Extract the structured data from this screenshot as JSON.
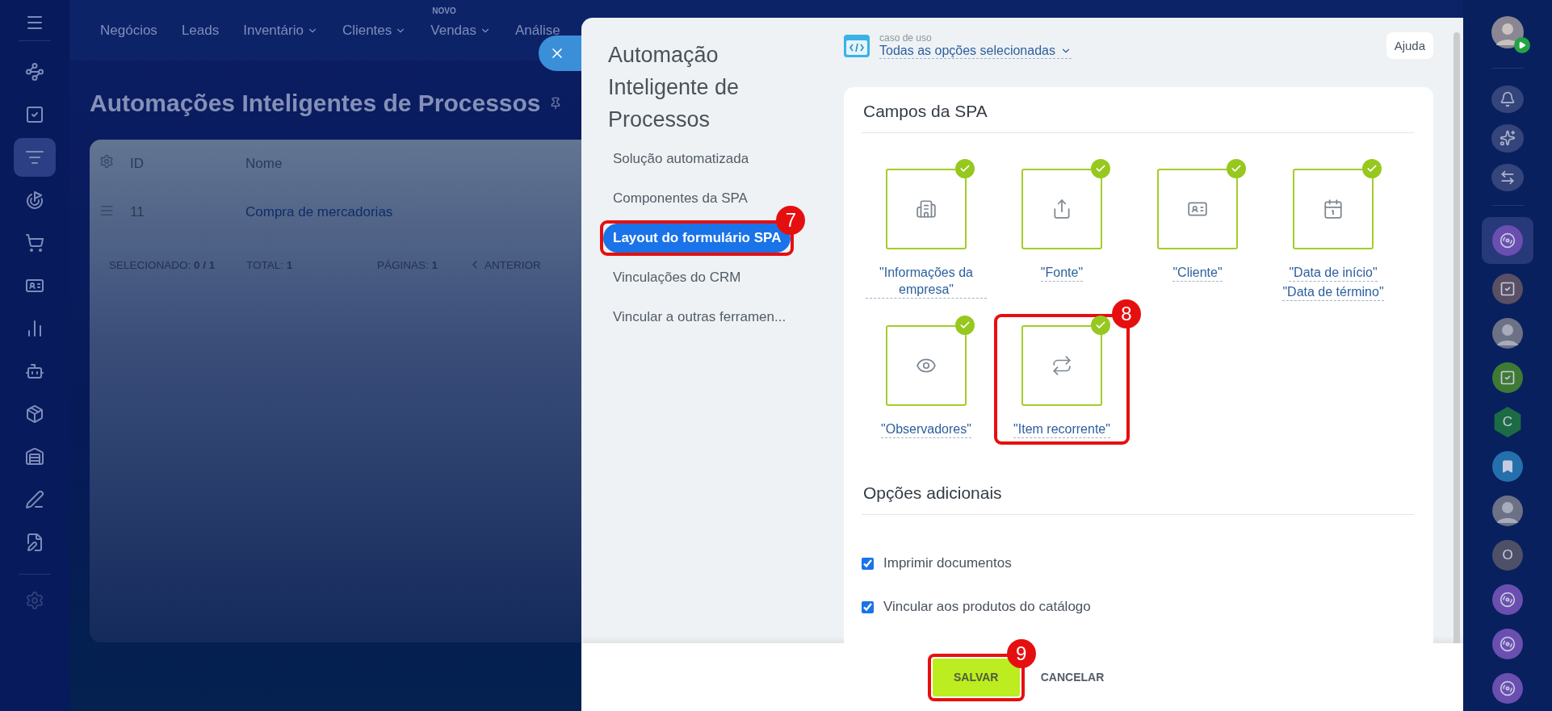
{
  "left_sidebar": {
    "items": [
      {
        "selected": false
      },
      {
        "selected": false
      },
      {
        "selected": true
      },
      {
        "selected": false
      },
      {
        "selected": false
      },
      {
        "selected": false
      },
      {
        "selected": false
      },
      {
        "selected": false
      },
      {
        "selected": false
      },
      {
        "selected": false
      },
      {
        "selected": false
      },
      {
        "selected": false
      }
    ]
  },
  "nav": [
    {
      "label": "Negócios",
      "dropdown": false
    },
    {
      "label": "Leads",
      "dropdown": false
    },
    {
      "label": "Inventário",
      "dropdown": true
    },
    {
      "label": "Clientes",
      "dropdown": true
    },
    {
      "label": "Vendas",
      "dropdown": true,
      "badge": "NOVO"
    },
    {
      "label": "Análise",
      "dropdown": false
    }
  ],
  "page": {
    "title": "Automações Inteligentes de Processos",
    "table": {
      "columns": [
        "ID",
        "Nome"
      ],
      "rows": [
        {
          "id": "11",
          "name": "Compra de mercadorias"
        }
      ],
      "footer": {
        "selected_label": "SELECIONADO:",
        "selected_value": "0 / 1",
        "total_label": "TOTAL:",
        "total_value": "1",
        "pages_label": "PÁGINAS:",
        "pages_value": "1",
        "prev": "ANTERIOR"
      }
    }
  },
  "slider": {
    "title": "Automação Inteligente de Processos",
    "menu": [
      {
        "label": "Solução automatizada",
        "selected": false
      },
      {
        "label": "Componentes da SPA",
        "selected": false
      },
      {
        "label": "Layout do formulário SPA",
        "selected": true,
        "annotation": "7"
      },
      {
        "label": "Vinculações do CRM",
        "selected": false
      },
      {
        "label": "Vincular a outras ferramen...",
        "selected": false
      }
    ],
    "use_case": {
      "caption": "caso de uso",
      "value": "Todas as opções selecionadas"
    },
    "help": "Ajuda",
    "fields_title": "Campos da SPA",
    "fields": [
      {
        "lines": [
          "\"Informações da empresa\""
        ],
        "checked": true
      },
      {
        "lines": [
          "\"Fonte\""
        ],
        "checked": true
      },
      {
        "lines": [
          "\"Cliente\""
        ],
        "checked": true
      },
      {
        "lines": [
          "\"Data de início\"",
          "\"Data de término\""
        ],
        "checked": true
      },
      {
        "lines": [
          "\"Observadores\""
        ],
        "checked": true
      },
      {
        "lines": [
          "\"Item recorrente\""
        ],
        "checked": true,
        "annotation": "8"
      }
    ],
    "options_title": "Opções adicionais",
    "options": [
      {
        "label": "Imprimir documentos",
        "checked": true
      },
      {
        "label": "Vincular aos produtos do catálogo",
        "checked": true
      }
    ],
    "buttons": {
      "save": "SALVAR",
      "save_annotation": "9",
      "cancel": "CANCELAR"
    }
  },
  "right_sidebar": {
    "chats": [
      {
        "kind": "bot",
        "color": "#6a4fb0",
        "selected": true
      },
      {
        "kind": "task",
        "color": "#5a4f63",
        "selected": false
      },
      {
        "kind": "photo",
        "selected": false
      },
      {
        "kind": "task",
        "color": "#3f7a35",
        "selected": false
      },
      {
        "kind": "hexletter",
        "letter": "C",
        "color": "#1d6b45",
        "selected": false
      },
      {
        "kind": "bookmark",
        "color": "#2470ad",
        "selected": false
      },
      {
        "kind": "photo",
        "selected": false
      },
      {
        "kind": "letter",
        "letter": "O",
        "color": "#4e5068",
        "selected": false
      },
      {
        "kind": "bot",
        "color": "#6a4fb0",
        "selected": false
      },
      {
        "kind": "bot",
        "color": "#6a4fb0",
        "selected": false
      },
      {
        "kind": "bot",
        "color": "#6a4fb0",
        "selected": false
      }
    ]
  }
}
